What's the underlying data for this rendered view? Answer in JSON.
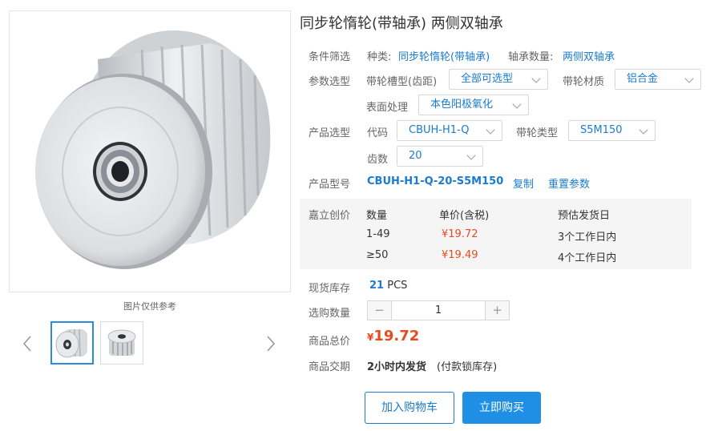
{
  "product": {
    "title": "同步轮惰轮(带轴承) 两侧双轴承",
    "image_caption": "图片仅供参考"
  },
  "filter": {
    "label": "条件筛选",
    "type_label": "种类:",
    "type_value": "同步轮惰轮(带轴承)",
    "bearing_label": "轴承数量:",
    "bearing_value": "两侧双轴承"
  },
  "params": {
    "label": "参数选型",
    "groove_label": "带轮槽型(齿距)",
    "groove_value": "全部可选型",
    "material_label": "带轮材质",
    "material_value": "铝合金",
    "surface_label": "表面处理",
    "surface_value": "本色阳极氧化"
  },
  "selection": {
    "label": "产品选型",
    "code_label": "代码",
    "code_value": "CBUH-H1-Q",
    "belt_label": "带轮类型",
    "belt_value": "S5M150",
    "teeth_label": "齿数",
    "teeth_value": "20"
  },
  "model": {
    "label": "产品型号",
    "value": "CBUH-H1-Q-20-S5M150",
    "copy": "复制",
    "reset": "重置参数"
  },
  "pricing": {
    "label": "嘉立创价",
    "headers": [
      "数量",
      "单价(含税)",
      "预估发货日"
    ],
    "rows": [
      {
        "qty": "1-49",
        "price": "¥19.72",
        "ship": "3个工作日内"
      },
      {
        "qty": "≥50",
        "price": "¥19.49",
        "ship": "4个工作日内"
      }
    ]
  },
  "stock": {
    "label": "现货库存",
    "count": "21",
    "unit": "PCS"
  },
  "quantity": {
    "label": "选购数量",
    "minus": "−",
    "value": "1",
    "plus": "+"
  },
  "total": {
    "label": "商品总价",
    "currency": "¥",
    "amount": "19.72"
  },
  "delivery": {
    "label": "商品交期",
    "value": "2小时内发货",
    "note": "(付款锁库存)"
  },
  "buttons": {
    "cart": "加入购物车",
    "buy": "立即购买"
  },
  "colors": {
    "accent": "#1a7bd0",
    "price_red": "#e84b20",
    "buy_button": "#1e8fe5"
  }
}
